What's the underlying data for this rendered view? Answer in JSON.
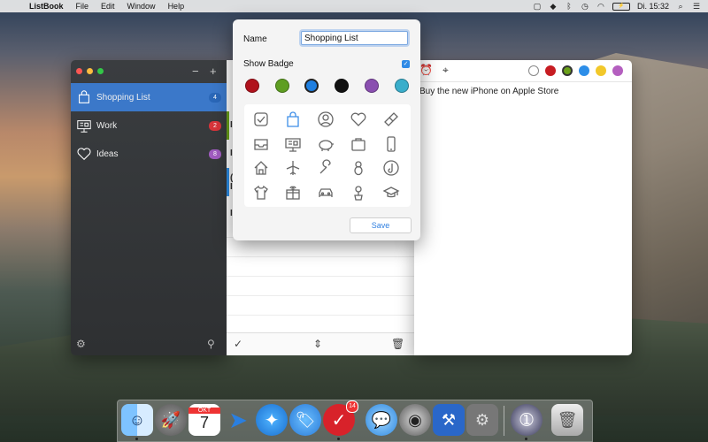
{
  "menubar": {
    "app_name": "ListBook",
    "items": [
      "File",
      "Edit",
      "Window",
      "Help"
    ],
    "clock": "Di. 15:32"
  },
  "sidebar": {
    "items": [
      {
        "label": "Shopping List",
        "badge": "4",
        "badge_color": "#2a67b8",
        "icon": "shopping-bag-icon"
      },
      {
        "label": "Work",
        "badge": "2",
        "badge_color": "#d8343a",
        "icon": "presentation-board-icon"
      },
      {
        "label": "Ideas",
        "badge": "8",
        "badge_color": "#a05bc0",
        "icon": "heart-icon"
      }
    ]
  },
  "detail": {
    "note_text": "Buy the new iPhone on Apple Store",
    "colors": [
      "#ffffff",
      "#c71c22",
      "#6aa019",
      "#2d8ee8",
      "#f2c82a",
      "#b45fbf"
    ]
  },
  "popover": {
    "name_label": "Name",
    "name_value": "Shopping List",
    "badge_label": "Show Badge",
    "badge_checked": true,
    "colors": [
      "#b0121c",
      "#5e9e22",
      "#1f7fe0",
      "#111111",
      "#8a4fb0",
      "#3aaecb"
    ],
    "selected_color": "#1f7fe0",
    "icons": [
      "checkbox-icon",
      "shopping-bag-icon",
      "person-icon",
      "heart-icon",
      "bandage-icon",
      "inbox-tray-icon",
      "presentation-board-icon",
      "piggy-bank-icon",
      "briefcase-icon",
      "phone-icon",
      "house-icon",
      "airplane-icon",
      "wrench-icon",
      "baby-icon",
      "music-note-icon",
      "tshirt-icon",
      "gift-icon",
      "car-icon",
      "plant-pot-icon",
      "graduation-cap-icon"
    ],
    "selected_icon": "shopping-bag-icon",
    "save_label": "Save"
  },
  "dock": {
    "calendar_month": "OKT",
    "calendar_day": "7",
    "listbook_badge": "14"
  }
}
